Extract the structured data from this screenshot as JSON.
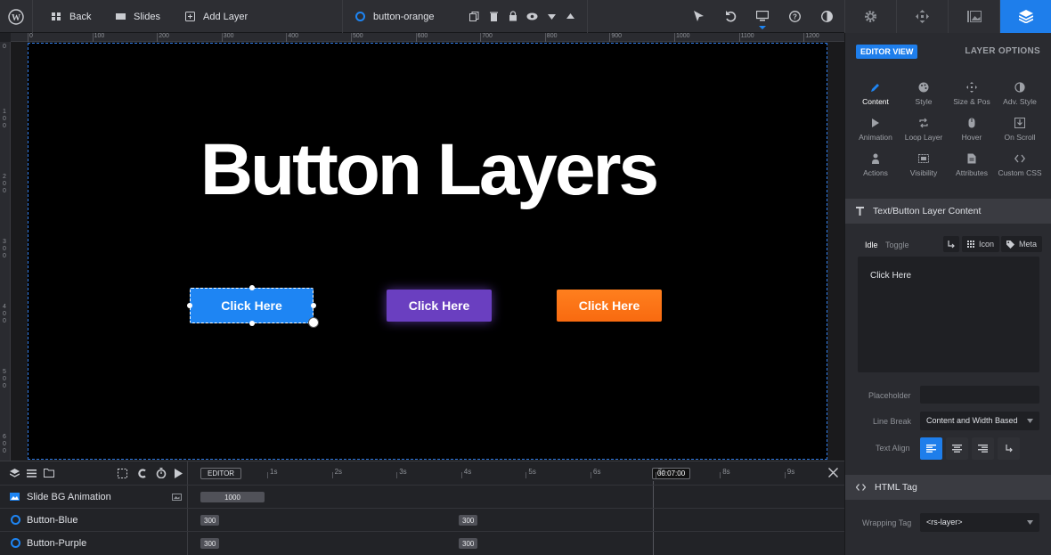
{
  "topbar": {
    "back_label": "Back",
    "slides_label": "Slides",
    "add_layer_label": "Add Layer",
    "layer_name": "button-orange"
  },
  "ruler": {
    "h_ticks": [
      "0",
      "100",
      "200",
      "300",
      "400",
      "500",
      "600",
      "700",
      "800",
      "900",
      "1000",
      "1100",
      "1200"
    ],
    "v_ticks": [
      "0",
      "100",
      "200",
      "300",
      "400",
      "500",
      "600"
    ]
  },
  "canvas": {
    "headline": "Button Layers",
    "buttons": [
      "Click Here",
      "Click Here",
      "Click Here"
    ],
    "colors": {
      "blue": "#1e85f3",
      "purple": "#6a3fc0",
      "orange": "#f97316"
    }
  },
  "timeline": {
    "editor_label": "EDITOR",
    "time_marks": [
      "1s",
      "2s",
      "3s",
      "4s",
      "5s",
      "6s",
      "7s",
      "8s",
      "9s"
    ],
    "current_time": "00:07:00",
    "rows": [
      {
        "label": "Slide BG Animation",
        "chips": [
          "1000"
        ]
      },
      {
        "label": "Button-Blue",
        "chips": [
          "300",
          "300"
        ]
      },
      {
        "label": "Button-Purple",
        "chips": [
          "300",
          "300"
        ]
      }
    ]
  },
  "panel": {
    "editor_view": "EDITOR VIEW",
    "layer_options": "LAYER OPTIONS",
    "options": [
      {
        "label": "Content",
        "icon": "pencil-icon"
      },
      {
        "label": "Style",
        "icon": "palette-icon"
      },
      {
        "label": "Size & Pos",
        "icon": "move-icon"
      },
      {
        "label": "Adv. Style",
        "icon": "contrast-icon"
      },
      {
        "label": "Animation",
        "icon": "play-icon"
      },
      {
        "label": "Loop Layer",
        "icon": "loop-icon"
      },
      {
        "label": "Hover",
        "icon": "mouse-icon"
      },
      {
        "label": "On Scroll",
        "icon": "scroll-icon"
      },
      {
        "label": "Actions",
        "icon": "hand-icon"
      },
      {
        "label": "Visibility",
        "icon": "visibility-icon"
      },
      {
        "label": "Attributes",
        "icon": "file-icon"
      },
      {
        "label": "Custom CSS",
        "icon": "code-icon"
      }
    ],
    "content_section": "Text/Button Layer Content",
    "idle_tab": "Idle",
    "toggle_tab": "Toggle",
    "icon_label": "Icon",
    "meta_label": "Meta",
    "text_value": "Click Here",
    "placeholder_label": "Placeholder",
    "line_break_label": "Line Break",
    "line_break_value": "Content and Width Based",
    "text_align_label": "Text Align",
    "html_tag_section": "HTML Tag",
    "wrapping_tag_label": "Wrapping Tag",
    "wrapping_tag_value": "<rs-layer>"
  }
}
